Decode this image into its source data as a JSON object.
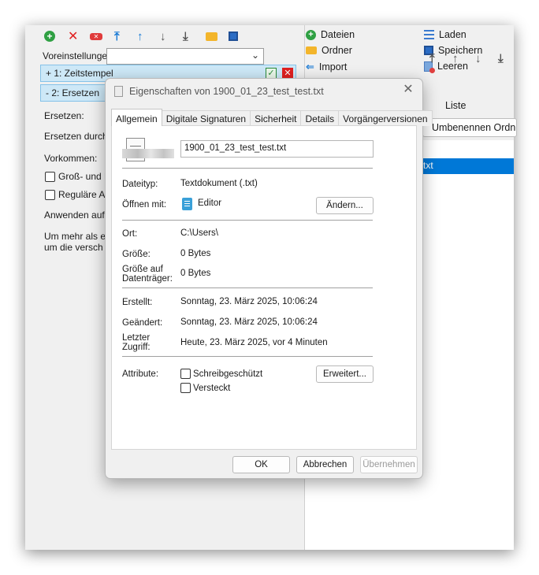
{
  "app": {
    "toolbar_icons": [
      "add-icon",
      "delete-icon",
      "eraser-icon",
      "move-top-icon",
      "move-up-icon",
      "move-down-icon",
      "move-bottom-icon",
      "folder-icon",
      "save-icon"
    ],
    "presets_label": "Voreinstellunge",
    "presets_value": "",
    "steps": [
      {
        "label": "+ 1: Zeitstempel"
      },
      {
        "label": "- 2: Ersetzen"
      }
    ],
    "replace_label": "Ersetzen:",
    "replace_with_label": "Ersetzen durch",
    "occurrences_label": "Vorkommen:",
    "case_option": "Groß- und K",
    "regex_option": "Reguläre Au",
    "apply_label": "Anwenden auf",
    "info_line1": "Um mehr als e",
    "info_line2": "um die versch",
    "right_menu": {
      "files": "Dateien",
      "folder": "Ordner",
      "import": "Import",
      "load": "Laden",
      "save": "Speichern",
      "clear": "Leeren"
    },
    "list_label": "Liste",
    "rename_button": "Umbenennen Ordne",
    "selected_item": "txt"
  },
  "dialog": {
    "title": "Eigenschaften von 1900_01_23_test_test.txt",
    "tabs": [
      "Allgemein",
      "Digitale Signaturen",
      "Sicherheit",
      "Details",
      "Vorgängerversionen"
    ],
    "active_tab": "Allgemein",
    "filename": "1900_01_23_test_test.txt",
    "filetype_label": "Dateityp:",
    "filetype_value": "Textdokument (.txt)",
    "openwith_label": "Öffnen mit:",
    "openwith_value": "Editor",
    "change_button": "Ändern...",
    "location_label": "Ort:",
    "location_value": "C:\\Users\\",
    "size_label": "Größe:",
    "size_value": "0 Bytes",
    "disk_size_label_1": "Größe auf",
    "disk_size_label_2": "Datenträger:",
    "disk_size_value": "0 Bytes",
    "created_label": "Erstellt:",
    "created_value": "Sonntag, 23. März 2025, 10:06:24",
    "modified_label": "Geändert:",
    "modified_value": "Sonntag, 23. März 2025, 10:06:24",
    "accessed_label_1": "Letzter",
    "accessed_label_2": "Zugriff:",
    "accessed_value": "Heute, 23. März 2025, vor 4 Minuten",
    "attributes_label": "Attribute:",
    "readonly_label": "Schreibgeschützt",
    "hidden_label": "Versteckt",
    "advanced_button": "Erweitert...",
    "ok_button": "OK",
    "cancel_button": "Abbrechen",
    "apply_button": "Übernehmen"
  }
}
